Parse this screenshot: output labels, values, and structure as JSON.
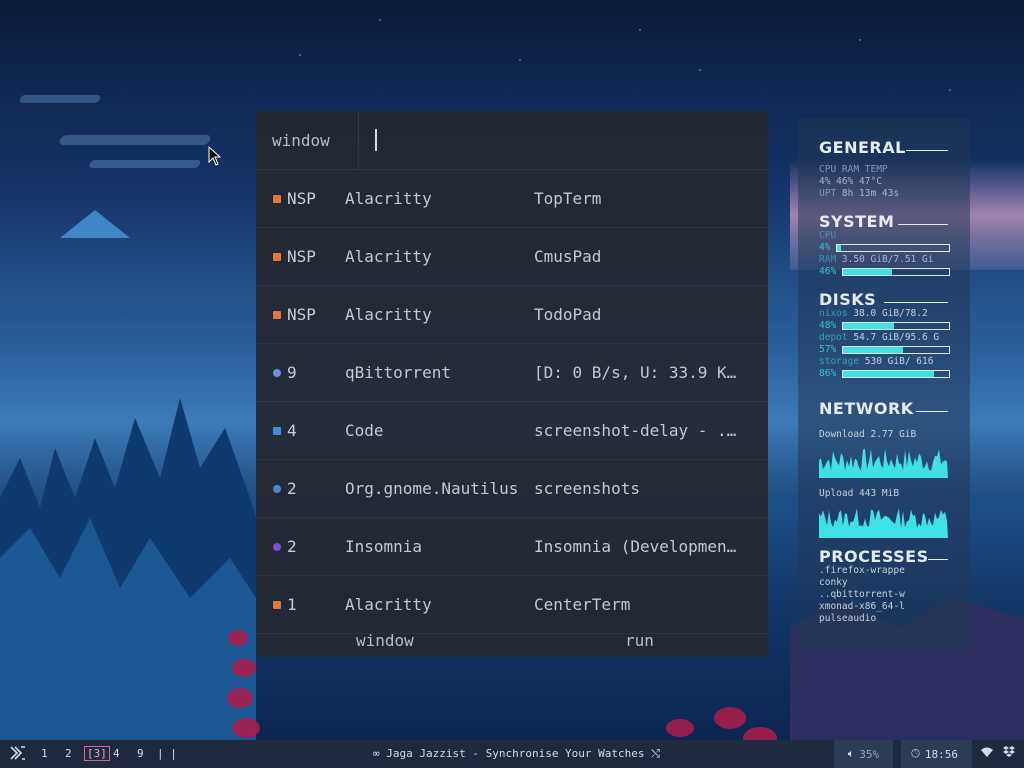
{
  "launcher": {
    "prompt": "window",
    "input_value": "",
    "rows": [
      {
        "icon": "alacritty-icon",
        "ws": "NSP",
        "cls": "Alacritty",
        "title": "TopTerm"
      },
      {
        "icon": "alacritty-icon",
        "ws": "NSP",
        "cls": "Alacritty",
        "title": "CmusPad"
      },
      {
        "icon": "alacritty-icon",
        "ws": "NSP",
        "cls": "Alacritty",
        "title": "TodoPad"
      },
      {
        "icon": "qbittorrent-icon",
        "ws": "9",
        "cls": "qBittorrent",
        "title": "[D: 0 B/s, U: 33.9 KiB…"
      },
      {
        "icon": "vscode-icon",
        "ws": "4",
        "cls": "Code",
        "title": "screenshot-delay - .do…"
      },
      {
        "icon": "nautilus-icon",
        "ws": "2",
        "cls": "Org.gnome.Nautilus",
        "title": "screenshots"
      },
      {
        "icon": "insomnia-icon",
        "ws": "2",
        "cls": "Insomnia",
        "title": "Insomnia (Development)…"
      },
      {
        "icon": "alacritty-icon",
        "ws": "1",
        "cls": "Alacritty",
        "title": "CenterTerm"
      }
    ],
    "modes": [
      "window",
      "run"
    ]
  },
  "conky": {
    "general": {
      "title": "GENERAL",
      "stats_line": "4%   46%   47°C",
      "uptime": "8h 13m 43s"
    },
    "system": {
      "title": "SYSTEM",
      "cpu_label": "CPU",
      "cpu_pct": "4%",
      "cpu_value": 0.04,
      "ram_label": "RAM",
      "ram_usage": "3.50 GiB/7.51 Gi",
      "ram_pct": "46%",
      "ram_value": 0.46
    },
    "disks": {
      "title": "DISKS",
      "items": [
        {
          "name": "nixos",
          "usage": "38.0 GiB/78.2",
          "pct": "48%",
          "value": 0.48
        },
        {
          "name": "depot",
          "usage": "54.7 GiB/95.6 G",
          "pct": "57%",
          "value": 0.57
        },
        {
          "name": "storage",
          "usage": "530 GiB/ 616",
          "pct": "86%",
          "value": 0.86
        }
      ]
    },
    "network": {
      "title": "NETWORK",
      "download": "Download 2.77 GiB",
      "upload": "Upload  443 MiB"
    },
    "processes": {
      "title": "PROCESSES",
      "items": [
        ".firefox-wrappe",
        "conky",
        "..qbittorrent-w",
        "xmonad-x86_64-l",
        "pulseaudio"
      ]
    }
  },
  "statusbar": {
    "workspaces": [
      "1",
      "2",
      "[3]",
      "4",
      "9",
      "| |"
    ],
    "now_playing": "Jaga Jazzist - Synchronise Your Watches",
    "volume": "35%",
    "time": "18:56",
    "colors": {
      "bar_bg": "#1f2a3f",
      "active_ws": "#d6649c",
      "accent": "#3fe0e8"
    }
  }
}
